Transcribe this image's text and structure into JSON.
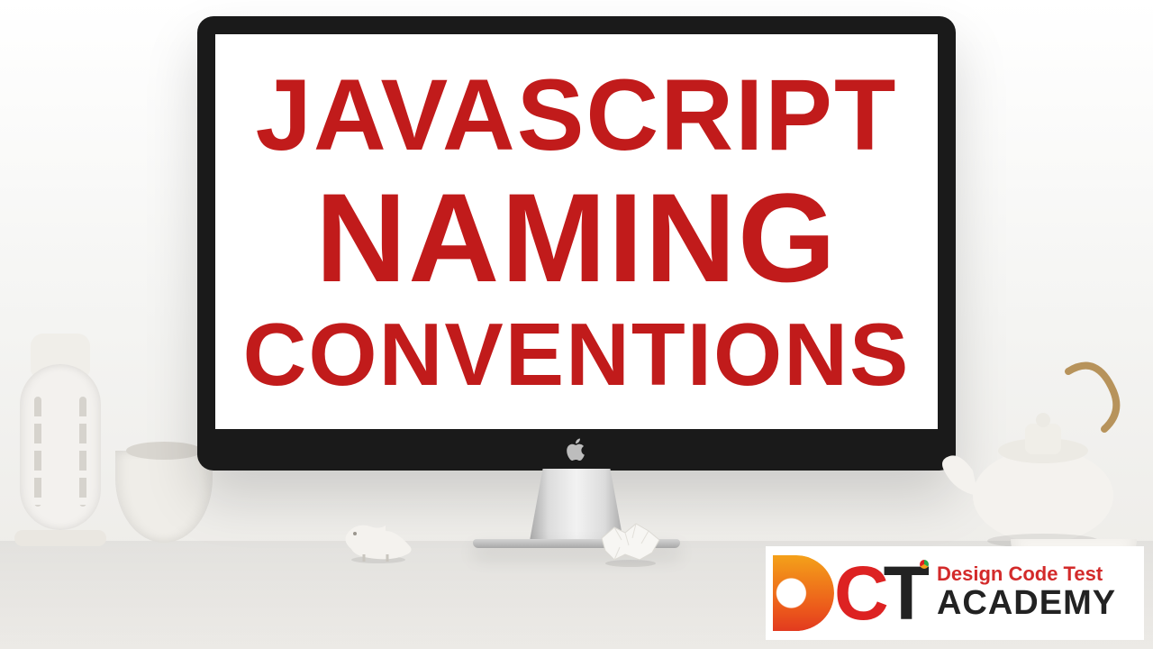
{
  "screen": {
    "line1": "JAVASCRIPT",
    "line2": "NAMING",
    "line3": "CONVENTIONS"
  },
  "brand": {
    "initial_d": "D",
    "initial_c": "C",
    "initial_t": "T",
    "tagline": "Design Code Test",
    "name": "ACADEMY"
  },
  "colors": {
    "headline_red": "#c11b1b",
    "brand_red": "#d22",
    "brand_orange": "#f4a11a"
  }
}
